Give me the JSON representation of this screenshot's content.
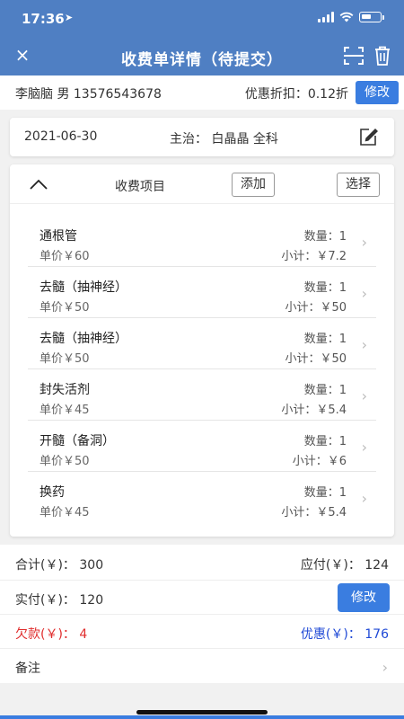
{
  "status_bar": {
    "time": "17:36"
  },
  "nav": {
    "title": "收费单详情（待提交）",
    "close": "×"
  },
  "patient": {
    "info": "李脑脑  男  13576543678",
    "discount": "优惠折扣：0.12折",
    "discount_btn": "修改"
  },
  "visit": {
    "date": "2021-06-30",
    "doctor": "主治：  白晶晶 全科"
  },
  "items_section": {
    "title": "收费项目",
    "add_btn": "添加",
    "choose_btn": "选择",
    "items": [
      {
        "name": "通根管",
        "price": "单价￥60",
        "qty": "数量：1",
        "subtotal": "小计：￥7.2"
      },
      {
        "name": "去髓（抽神经）",
        "price": "单价￥50",
        "qty": "数量：1",
        "subtotal": "小计：￥50"
      },
      {
        "name": "去髓（抽神经）",
        "price": "单价￥50",
        "qty": "数量：1",
        "subtotal": "小计：￥50"
      },
      {
        "name": "封失活剂",
        "price": "单价￥45",
        "qty": "数量：1",
        "subtotal": "小计：￥5.4"
      },
      {
        "name": "开髓（备洞）",
        "price": "单价￥50",
        "qty": "数量：1",
        "subtotal": "小计：￥6"
      },
      {
        "name": "换药",
        "price": "单价￥45",
        "qty": "数量：1",
        "subtotal": "小计：￥5.4"
      }
    ]
  },
  "summary": {
    "total": "合计(￥)：  300",
    "payable": "应付(￥)：  124",
    "paid": "实付(￥)：  120",
    "pay_btn": "修改",
    "owed": "欠款(￥)：  4",
    "discount_amount": "优惠(￥)：  176",
    "remark": "备注"
  },
  "colors": {
    "header": "#4f7fc3",
    "accent": "#3a7de0",
    "owed": "#e02d2d",
    "discount": "#1f49d6"
  }
}
